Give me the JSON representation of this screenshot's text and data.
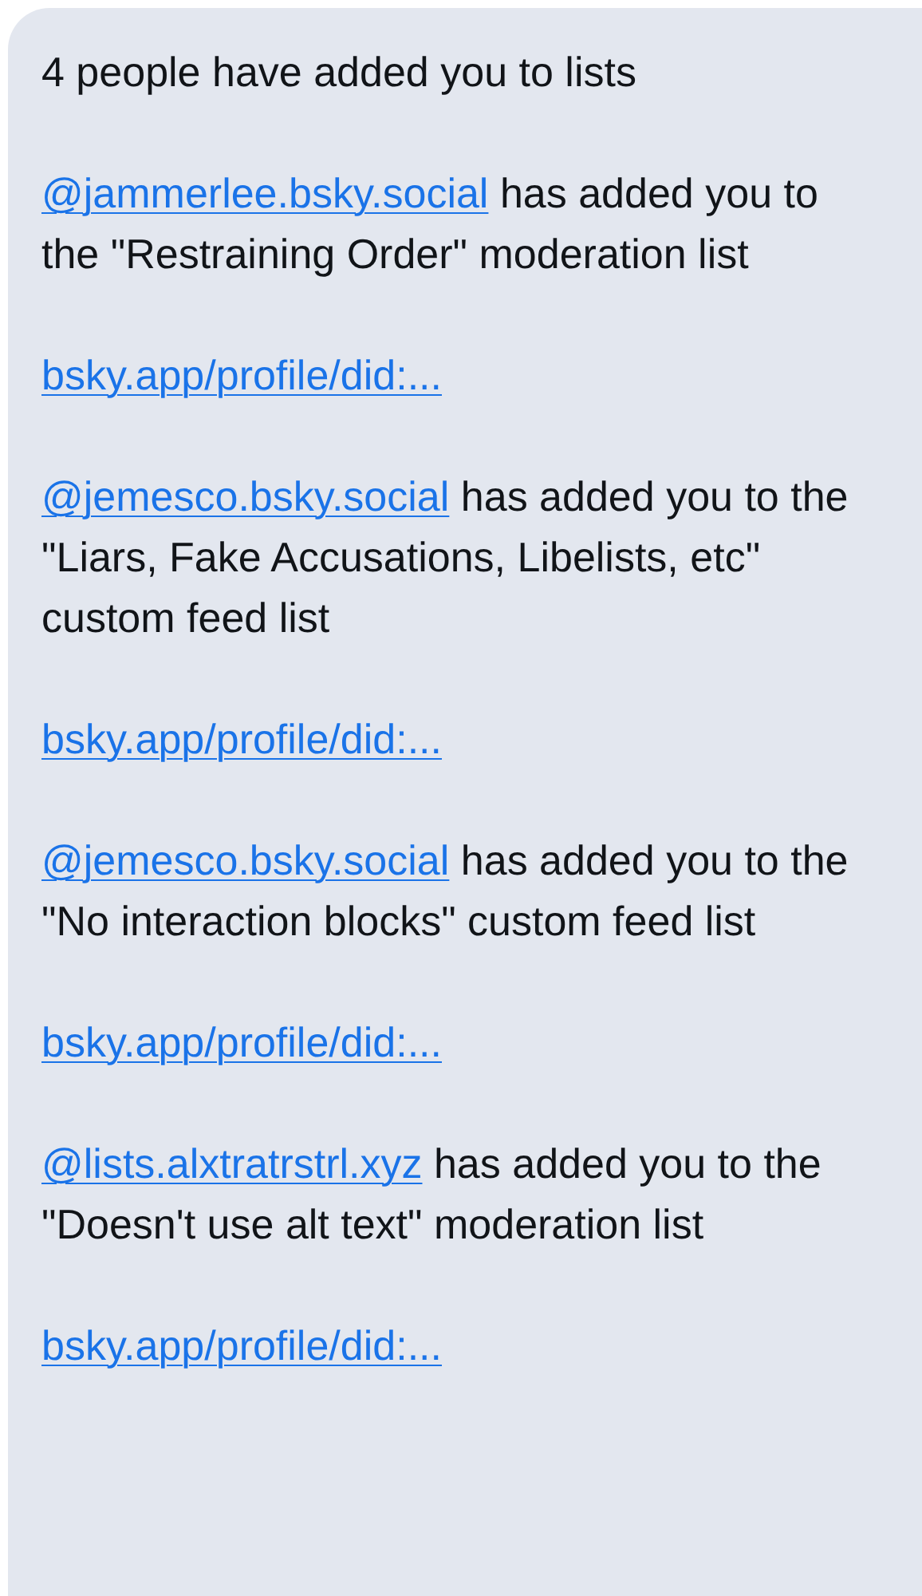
{
  "message": {
    "heading": "4 people have added you to lists",
    "items": [
      {
        "handle": "@jammerlee.bsky.social",
        "text": " has added you to the \"Restraining Order\" moderation list",
        "link": "bsky.app/profile/did:..."
      },
      {
        "handle": "@jemesco.bsky.social",
        "text": " has added you to the \"Liars, Fake Accusations, Libelists, etc\" custom feed list",
        "link": "bsky.app/profile/did:..."
      },
      {
        "handle": "@jemesco.bsky.social",
        "text": " has added you to the \"No interaction blocks\" custom feed list",
        "link": "bsky.app/profile/did:..."
      },
      {
        "handle": "@lists.alxtratrstrl.xyz",
        "text": " has added you to the \"Doesn't use alt text\" moderation list",
        "link": "bsky.app/profile/did:..."
      }
    ]
  }
}
